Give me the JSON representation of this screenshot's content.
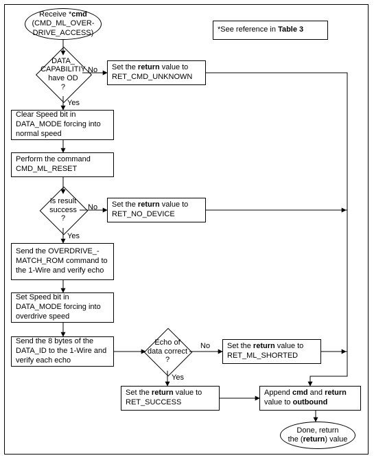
{
  "chart_data": {
    "type": "flowchart",
    "title_note": "*See reference in Table 3",
    "nodes": [
      {
        "id": "start",
        "kind": "terminator",
        "text": "Receive *cmd (CMD_ML_OVER-DRIVE_ACCESS)"
      },
      {
        "id": "dec_cap",
        "kind": "decision",
        "text": "DATA_ CAPABILITIY have OD ?",
        "yes_to": "clear_speed",
        "no_to": "ret_unknown"
      },
      {
        "id": "ret_unknown",
        "kind": "process",
        "text": "Set the return value to RET_CMD_UNKNOWN"
      },
      {
        "id": "clear_speed",
        "kind": "process",
        "text": "Clear Speed bit in DATA_MODE forcing into normal speed"
      },
      {
        "id": "do_reset",
        "kind": "process",
        "text": "Perform the command CMD_ML_RESET"
      },
      {
        "id": "dec_success",
        "kind": "decision",
        "text": "Is result success ?",
        "yes_to": "send_ovr",
        "no_to": "ret_nodev"
      },
      {
        "id": "ret_nodev",
        "kind": "process",
        "text": "Set the return value to RET_NO_DEVICE"
      },
      {
        "id": "send_ovr",
        "kind": "process",
        "text": "Send the OVERDRIVE_-MATCH_ROM command to the 1-Wire and verify echo"
      },
      {
        "id": "set_speed",
        "kind": "process",
        "text": "Set Speed bit in DATA_MODE forcing into overdrive speed"
      },
      {
        "id": "send8",
        "kind": "process",
        "text": "Send the 8 bytes of the DATA_ID to the 1-Wire and verify each echo"
      },
      {
        "id": "dec_echo",
        "kind": "decision",
        "text": "Echo of data correct ?",
        "yes_to": "ret_success",
        "no_to": "ret_shorted"
      },
      {
        "id": "ret_shorted",
        "kind": "process",
        "text": "Set the return value to RET_ML_SHORTED"
      },
      {
        "id": "ret_success",
        "kind": "process",
        "text": "Set the return value to RET_SUCCESS"
      },
      {
        "id": "append",
        "kind": "process",
        "text": "Append cmd and return value to outbound"
      },
      {
        "id": "done",
        "kind": "terminator",
        "text": "Done, return the (return) value"
      }
    ],
    "edge_labels": {
      "yes": "Yes",
      "no": "No"
    }
  },
  "note_box": "*See reference in Table 3",
  "start_text_line1": "Receive *cmd",
  "start_text_line2": "(CMD_ML_OVER-",
  "start_text_line3": "DRIVE_ACCESS)",
  "dec_cap_line1": "DATA_",
  "dec_cap_line2": "CAPABILITIY",
  "dec_cap_line3": "have OD",
  "dec_cap_line4": "?",
  "ret_unknown_line1": "Set the return value to",
  "ret_unknown_line2": "RET_CMD_UNKNOWN",
  "clear_speed_text": "Clear Speed bit in DATA_MODE forcing into normal speed",
  "do_reset_text": "Perform the command CMD_ML_RESET",
  "dec_success_line1": "Is result",
  "dec_success_line2": "success",
  "dec_success_line3": "?",
  "ret_nodev_line1": "Set the return value to",
  "ret_nodev_line2": "RET_NO_DEVICE",
  "send_ovr_text": "Send the OVERDRIVE_-MATCH_ROM command  to the 1-Wire and verify echo",
  "set_speed_text": "Set Speed bit in DATA_MODE forcing into overdrive speed",
  "send8_text": "Send the 8 bytes of the DATA_ID to the 1-Wire and verify each echo",
  "dec_echo_line1": "Echo of",
  "dec_echo_line2": "data correct",
  "dec_echo_line3": "?",
  "ret_shorted_line1": "Set the return value to",
  "ret_shorted_line2": "RET_ML_SHORTED",
  "ret_success_line1": "Set the return value to",
  "ret_success_line2": "RET_SUCCESS",
  "append_line1": "Append cmd and return",
  "append_line2": "value to outbound",
  "done_line1": "Done, return",
  "done_line2": "the (return) value",
  "labels": {
    "yes": "Yes",
    "no": "No"
  },
  "bold": {
    "cmd": "cmd",
    "ret": "return",
    "outbound": "outbound",
    "table3": "Table 3"
  }
}
